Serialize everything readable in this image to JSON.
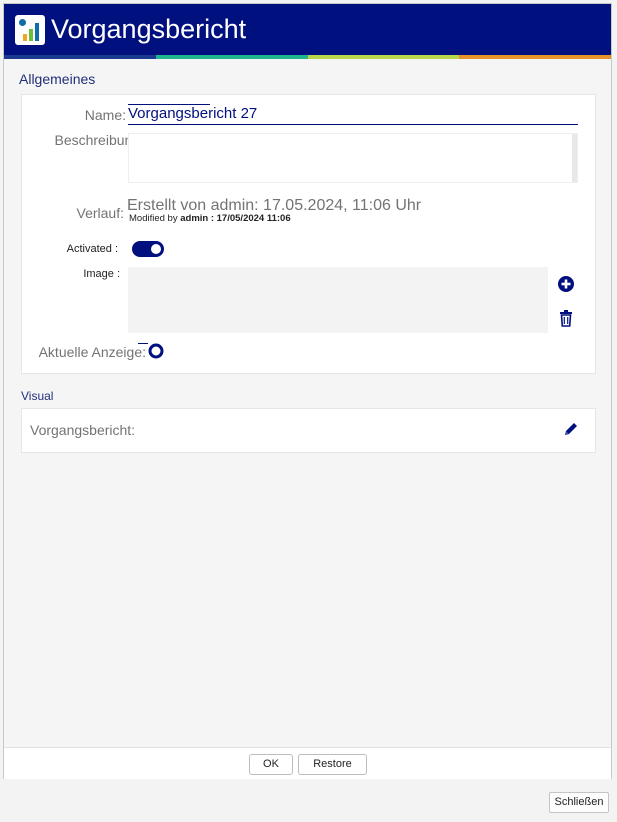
{
  "window": {
    "title": "Vorgangsbericht"
  },
  "stripe_colors": [
    "#1a3a8f",
    "#1fb58f",
    "#b8d64a",
    "#e8922a"
  ],
  "sections": {
    "general": {
      "label": "Allgemeines",
      "name": {
        "label": "Name:",
        "value": "Vorgangsbericht 27"
      },
      "description": {
        "label": "Beschreibung:",
        "value": ""
      },
      "history": {
        "label": "Verlauf:",
        "created": "Erstellt von admin: 17.05.2024, 11:06 Uhr",
        "modified_prefix": "Modified by ",
        "modified_value": "admin : 17/05/2024 11:06"
      },
      "activated": {
        "label": "Activated :",
        "value": true
      },
      "image": {
        "label": "Image :",
        "add_icon": "plus-circle-icon",
        "delete_icon": "trash-icon"
      },
      "current_display": {
        "label": "Aktuelle Anzeige:",
        "value": false
      }
    },
    "visual": {
      "label": "Visual",
      "item_label": "Vorgangsbericht:",
      "edit_icon": "pencil-icon"
    }
  },
  "footer": {
    "ok": "OK",
    "restore": "Restore"
  },
  "close": "Schließen"
}
